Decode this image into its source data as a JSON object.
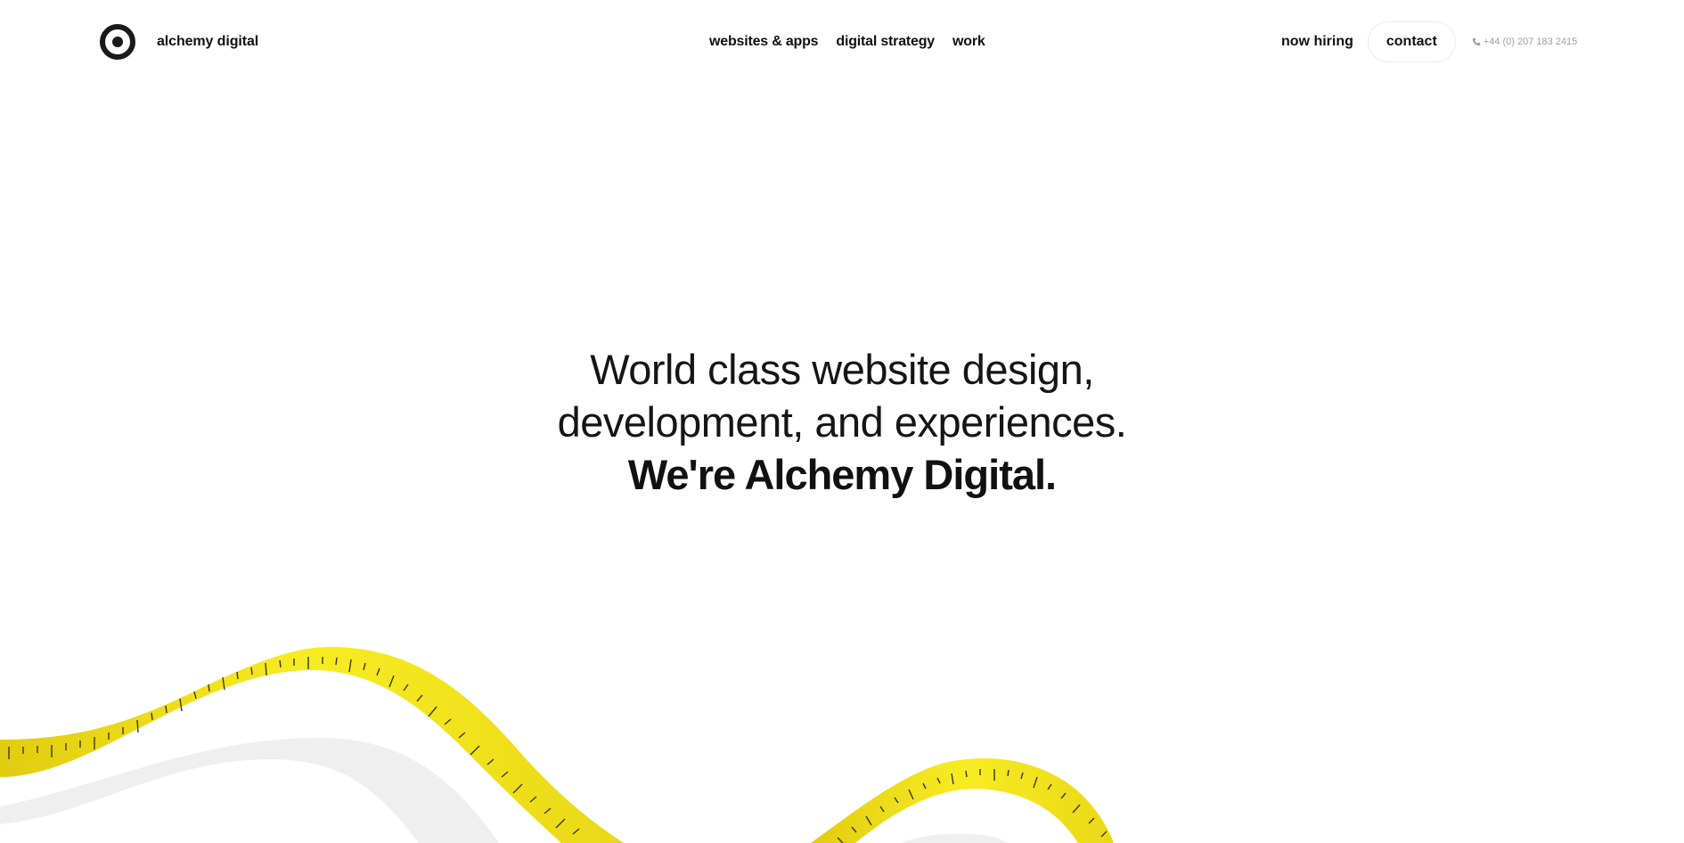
{
  "header": {
    "brand_name": "alchemy digital",
    "logo_icon": "target-ring-icon",
    "nav": [
      {
        "label": "websites & apps"
      },
      {
        "label": "digital strategy"
      },
      {
        "label": "work"
      }
    ],
    "hiring_label": "now hiring",
    "contact_label": "contact",
    "phone": "+44 (0) 207 183 2415",
    "phone_icon": "phone-icon"
  },
  "hero": {
    "line1": "World class website design,",
    "line2": "development, and experiences.",
    "line3": "We're Alchemy Digital."
  },
  "decor": {
    "tape_color": "#f2e21c",
    "tape_shadow_color": "#ececec",
    "tape_tick_color": "#3a3a1a"
  }
}
